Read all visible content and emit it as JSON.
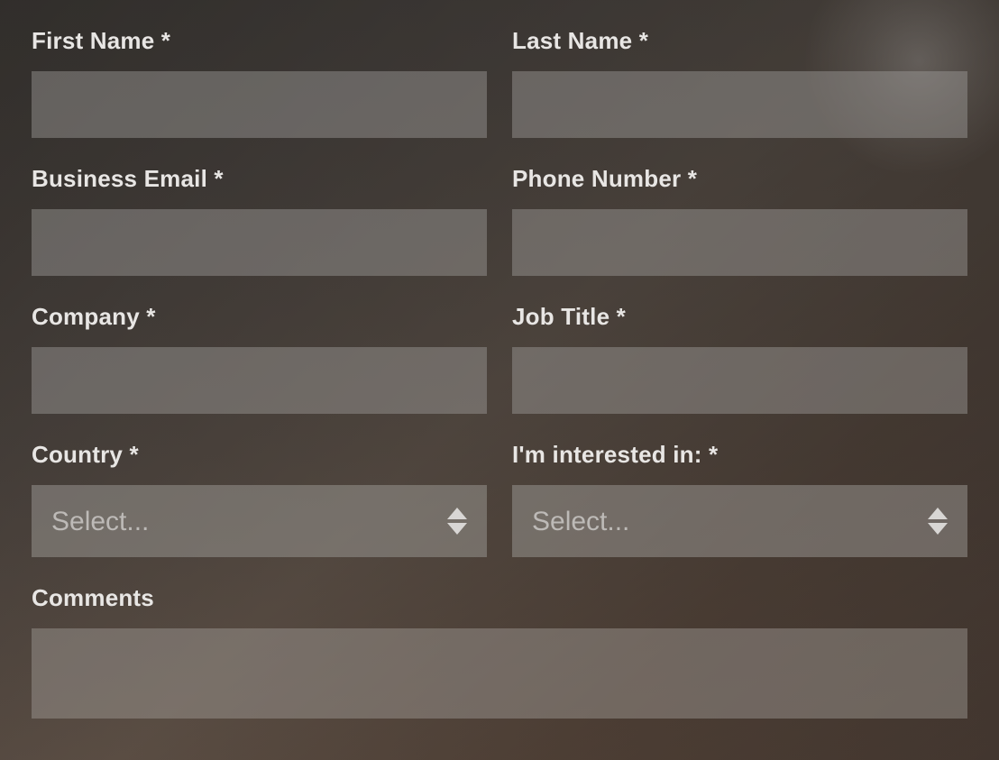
{
  "form": {
    "first_name": {
      "label": "First Name *",
      "value": ""
    },
    "last_name": {
      "label": "Last Name *",
      "value": ""
    },
    "business_email": {
      "label": "Business Email *",
      "value": ""
    },
    "phone_number": {
      "label": "Phone Number *",
      "value": ""
    },
    "company": {
      "label": "Company *",
      "value": ""
    },
    "job_title": {
      "label": "Job Title *",
      "value": ""
    },
    "country": {
      "label": "Country *",
      "placeholder": "Select...",
      "value": ""
    },
    "interested_in": {
      "label": "I'm interested in: *",
      "placeholder": "Select...",
      "value": ""
    },
    "comments": {
      "label": "Comments",
      "value": ""
    }
  }
}
